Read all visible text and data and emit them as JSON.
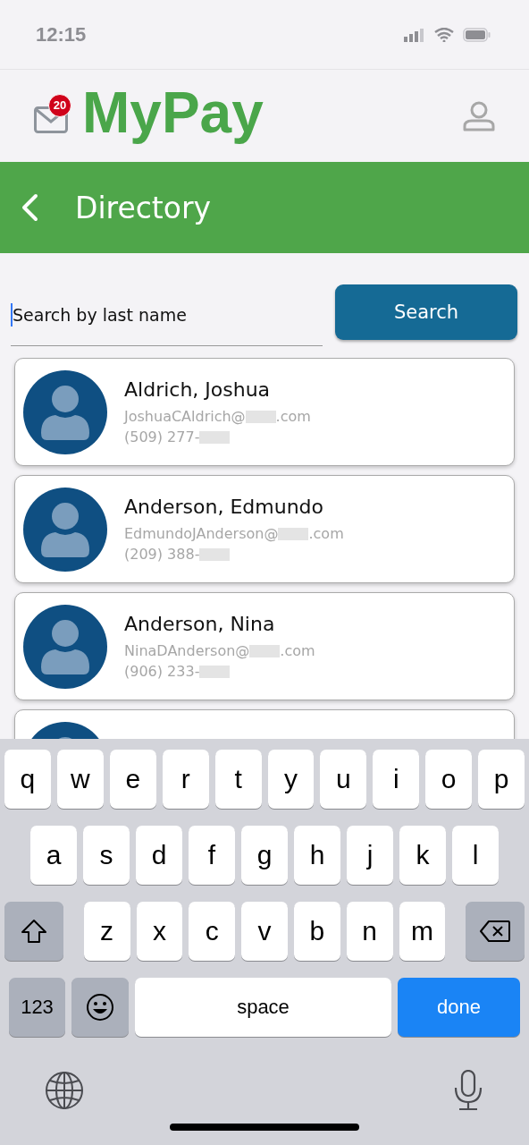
{
  "status_bar": {
    "time": "12:15"
  },
  "header": {
    "logo": "MyPay",
    "mail_badge": "20"
  },
  "title_bar": {
    "title": "Directory"
  },
  "search": {
    "placeholder": "Search by last name",
    "button": "Search"
  },
  "contacts": [
    {
      "kind": "full",
      "name": "Aldrich, Joshua",
      "email_user": "JoshuaCAldrich@",
      "email_end": ".com",
      "phone": "(509) 277-"
    },
    {
      "kind": "full",
      "name": "Anderson, Edmundo",
      "email_user": "EdmundoJAnderson@",
      "email_end": ".com",
      "phone": "(209) 388-"
    },
    {
      "kind": "full",
      "name": "Anderson, Nina",
      "email_user": "NinaDAnderson@",
      "email_end": ".com",
      "phone": "(906) 233-"
    },
    {
      "kind": "partial"
    }
  ],
  "keyboard": {
    "rows": [
      {
        "keys": [
          {
            "kind": "letter",
            "label": "q"
          },
          {
            "kind": "letter",
            "label": "w"
          },
          {
            "kind": "letter",
            "label": "e"
          },
          {
            "kind": "letter",
            "label": "r"
          },
          {
            "kind": "letter",
            "label": "t"
          },
          {
            "kind": "letter",
            "label": "y"
          },
          {
            "kind": "letter",
            "label": "u"
          },
          {
            "kind": "letter",
            "label": "i"
          },
          {
            "kind": "letter",
            "label": "o"
          },
          {
            "kind": "letter",
            "label": "p"
          }
        ]
      },
      {
        "keys": [
          {
            "kind": "letter",
            "label": "a"
          },
          {
            "kind": "letter",
            "label": "s"
          },
          {
            "kind": "letter",
            "label": "d"
          },
          {
            "kind": "letter",
            "label": "f"
          },
          {
            "kind": "letter",
            "label": "g"
          },
          {
            "kind": "letter",
            "label": "h"
          },
          {
            "kind": "letter",
            "label": "j"
          },
          {
            "kind": "letter",
            "label": "k"
          },
          {
            "kind": "letter",
            "label": "l"
          }
        ]
      },
      {
        "keys": [
          {
            "kind": "shift"
          },
          {
            "kind": "letter",
            "label": "z"
          },
          {
            "kind": "letter",
            "label": "x"
          },
          {
            "kind": "letter",
            "label": "c"
          },
          {
            "kind": "letter",
            "label": "v"
          },
          {
            "kind": "letter",
            "label": "b"
          },
          {
            "kind": "letter",
            "label": "n"
          },
          {
            "kind": "letter",
            "label": "m"
          },
          {
            "kind": "backspace"
          }
        ]
      },
      {
        "keys": [
          {
            "kind": "numbers",
            "label": "123"
          },
          {
            "kind": "emoji"
          },
          {
            "kind": "space",
            "label": "space"
          },
          {
            "kind": "done",
            "label": "done"
          }
        ]
      }
    ]
  }
}
